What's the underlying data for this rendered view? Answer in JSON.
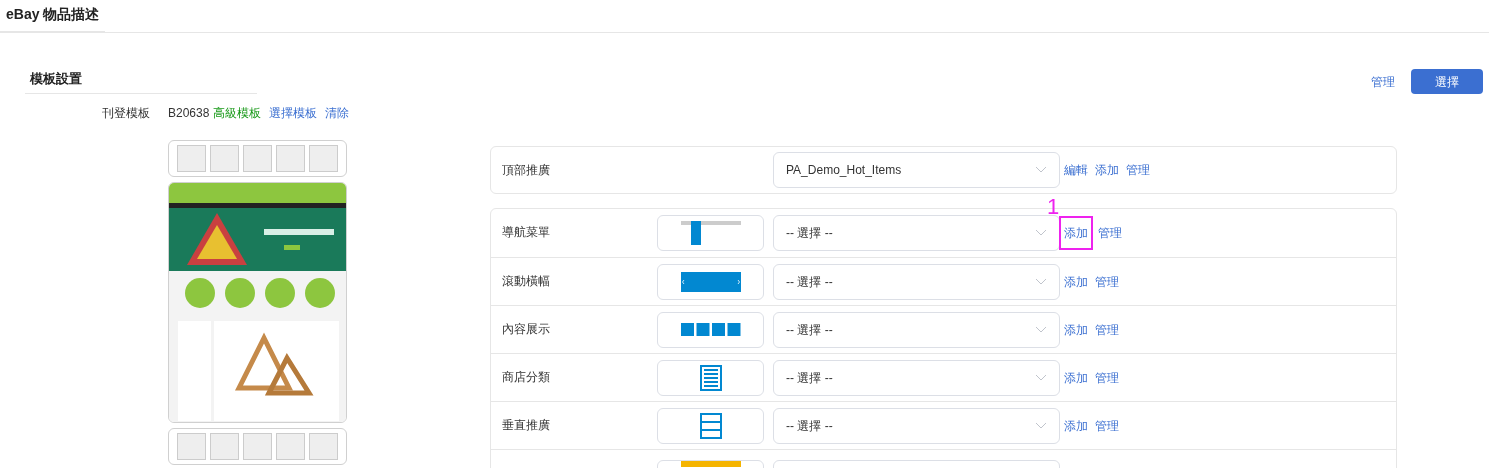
{
  "page_tab": {
    "title": "eBay 物品描述"
  },
  "section": {
    "title": "模板設置",
    "manage_link": "管理",
    "select_button": "選擇"
  },
  "listing_template": {
    "label": "刊登模板",
    "code": "B20638",
    "tier": "高級模板",
    "links": [
      "選擇模板",
      "清除"
    ]
  },
  "top_promo": {
    "label": "頂部推廣",
    "value": "PA_Demo_Hot_Items",
    "actions": [
      {
        "label": "編輯",
        "highlighted": false
      },
      {
        "label": "添加",
        "highlighted": false
      },
      {
        "label": "管理",
        "highlighted": false
      }
    ]
  },
  "annotation": {
    "label": "1"
  },
  "modules": [
    {
      "label": "導航菜單",
      "kind": "nav-menu",
      "value": "-- 選擇 --",
      "actions": [
        {
          "label": "添加",
          "highlighted": true
        },
        {
          "label": "管理",
          "highlighted": false
        }
      ]
    },
    {
      "label": "滾動橫幅",
      "kind": "slider",
      "value": "-- 選擇 --",
      "actions": [
        {
          "label": "添加",
          "highlighted": false
        },
        {
          "label": "管理",
          "highlighted": false
        }
      ]
    },
    {
      "label": "內容展示",
      "kind": "content-grid",
      "value": "-- 選擇 --",
      "actions": [
        {
          "label": "添加",
          "highlighted": false
        },
        {
          "label": "管理",
          "highlighted": false
        }
      ]
    },
    {
      "label": "商店分類",
      "kind": "category-list",
      "value": "-- 選擇 --",
      "actions": [
        {
          "label": "添加",
          "highlighted": false
        },
        {
          "label": "管理",
          "highlighted": false
        }
      ]
    },
    {
      "label": "垂直推廣",
      "kind": "vertical-list",
      "value": "-- 選擇 --",
      "actions": [
        {
          "label": "添加",
          "highlighted": false
        },
        {
          "label": "管理",
          "highlighted": false
        }
      ]
    },
    {
      "kind": "yellow-banner"
    }
  ]
}
